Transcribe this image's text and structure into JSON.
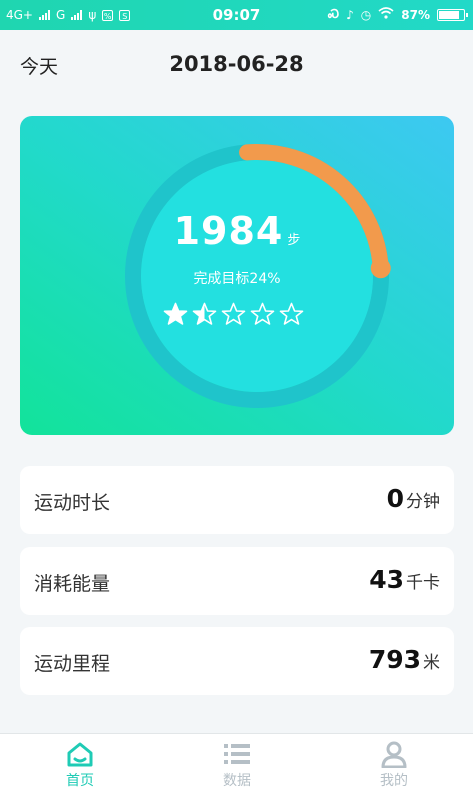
{
  "status_bar": {
    "network_1": "4G+",
    "network_2": "G",
    "time": "09:07",
    "battery": "87%",
    "battery_level": 0.87
  },
  "header": {
    "left_label": "今天",
    "date": "2018-06-28"
  },
  "activity": {
    "steps": "1984",
    "steps_unit": "步",
    "goal_text": "完成目标24%",
    "goal_progress": 0.24,
    "rating": 1.5,
    "rating_max": 5,
    "accent_color": "#f29a4c"
  },
  "stats": [
    {
      "label": "运动时长",
      "value": "0",
      "unit": "分钟"
    },
    {
      "label": "消耗能量",
      "value": "43",
      "unit": "千卡"
    },
    {
      "label": "运动里程",
      "value": "793",
      "unit": "米"
    }
  ],
  "tabs": [
    {
      "label": "首页",
      "icon": "home-icon",
      "active": true
    },
    {
      "label": "数据",
      "icon": "list-icon",
      "active": false
    },
    {
      "label": "我的",
      "icon": "person-icon",
      "active": false
    }
  ],
  "colors": {
    "active_tab": "#1fcbb5",
    "inactive_tab": "#b5bfc6"
  }
}
